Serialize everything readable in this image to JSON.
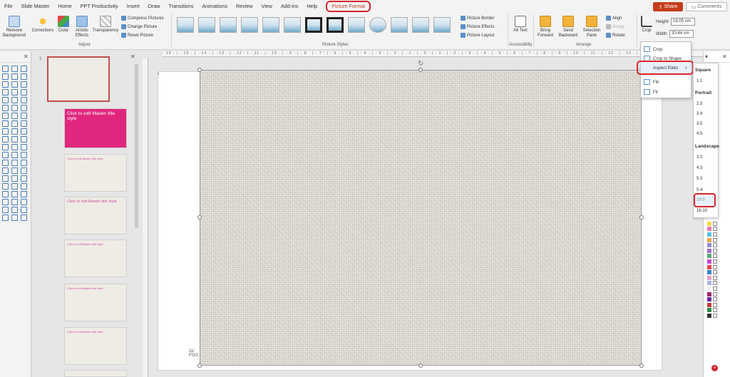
{
  "menu": {
    "tabs": [
      "File",
      "Slide Master",
      "Home",
      "PPT Productivity",
      "Insert",
      "Draw",
      "Transitions",
      "Animations",
      "Review",
      "View",
      "Add-ins",
      "Help",
      "Picture Format"
    ],
    "share_label": "Share",
    "comments_label": "Comments"
  },
  "ribbon": {
    "remove_background": "Remove Background",
    "corrections": "Corrections",
    "color": "Color",
    "artistic_effects": "Artistic Effects",
    "transparency": "Transparency",
    "compress_pictures": "Compress Pictures",
    "change_picture": "Change Picture",
    "reset_picture": "Reset Picture",
    "adjust_group": "Adjust",
    "picture_styles_group": "Picture Styles",
    "picture_border": "Picture Border",
    "picture_effects": "Picture Effects",
    "picture_layout": "Picture Layout",
    "alt_text": "Alt Text",
    "accessibility_group": "Accessibility",
    "bring_forward": "Bring Forward",
    "send_backward": "Send Backward",
    "selection_pane": "Selection Pane",
    "align": "Align",
    "group": "Group",
    "rotate": "Rotate",
    "arrange_group": "Arrange",
    "crop": "Crop",
    "height_label": "Height:",
    "height_value": "19.05 cm",
    "width_label": "Width:",
    "width_value": "20.44 cm"
  },
  "crop_menu": {
    "crop": "Crop",
    "crop_to_shape": "Crop to Shape",
    "aspect_ratio": "Aspect Ratio",
    "fill": "Fill",
    "fit": "Fit"
  },
  "aspect_ratio": {
    "square_header": "Square",
    "square": [
      "1:1"
    ],
    "portrait_header": "Portrait",
    "portrait": [
      "2:3",
      "3:4",
      "3:5",
      "4:5"
    ],
    "landscape_header": "Landscape",
    "landscape": [
      "3:2",
      "4:3",
      "5:3",
      "5:4",
      "16:9",
      "16:10"
    ]
  },
  "thumbnails": {
    "first_number": "1",
    "master_title": "Click to edit Master title style"
  },
  "slide": {
    "footer_fragment": "11/",
    "footer_fragment2": "FOO"
  },
  "ruler_text": "· 16 · | · 15 · | · 14 · | · 13 · | · 12 · | · 11 · | · 10 · | · 9 · | · 8 · | · 7 · | · 6 · | · 5 · | · 4 · | · 3 · | · 2 · | · 1 · | · 0 · | · 1 · | · 2 · | · 3 · | · 4 · | · 5 · | · 6 · | · 7 · | · 8 · | · 9 · | · 10 · | · 11 · | · 12 · | · 13 · | · 14 · | · 15 ·"
}
